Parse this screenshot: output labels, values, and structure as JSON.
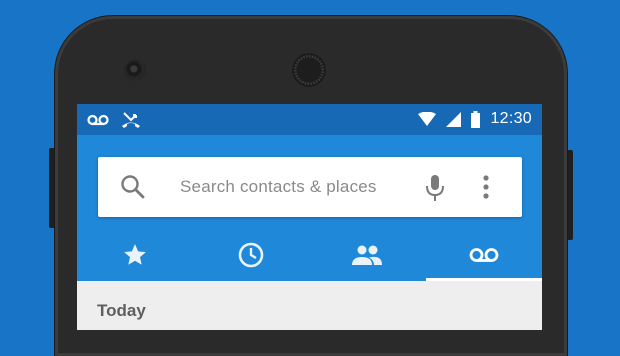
{
  "status_bar": {
    "time": "12:30",
    "left_icons": [
      "voicemail-icon",
      "missed-call-icon"
    ],
    "right_icons": [
      "wifi-icon",
      "signal-icon",
      "battery-icon"
    ]
  },
  "search": {
    "placeholder": "Search contacts & places",
    "icons": [
      "search-icon",
      "mic-icon",
      "more-vert-icon"
    ]
  },
  "tabs": [
    {
      "icon": "star-icon",
      "meaning": "favorites",
      "active": false
    },
    {
      "icon": "clock-icon",
      "meaning": "recents",
      "active": false
    },
    {
      "icon": "people-icon",
      "meaning": "contacts",
      "active": false
    },
    {
      "icon": "voicemail-icon",
      "meaning": "voicemail",
      "active": true
    }
  ],
  "content": {
    "section_header": "Today"
  },
  "colors": {
    "background": "#1874c6",
    "status_bar": "#1769b5",
    "app_bar": "#1f88d8",
    "screen_bg": "#eeeeee",
    "phone_body": "#2a2a2a"
  }
}
